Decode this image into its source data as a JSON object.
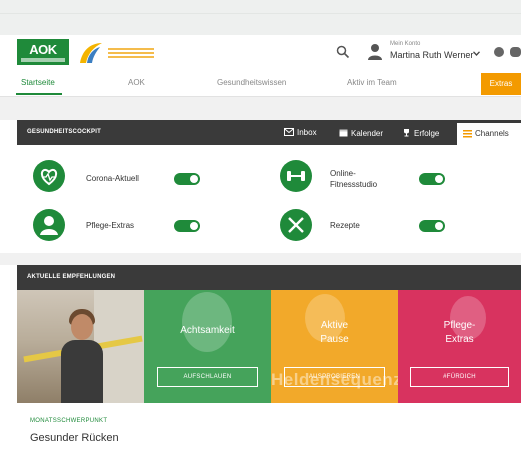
{
  "header": {
    "account_label": "Mein Konto",
    "account_name": "Martina Ruth Werner"
  },
  "nav": {
    "items": [
      "Startseite",
      "AOK",
      "Gesundheitswissen",
      "Aktiv im Team",
      "Extras"
    ],
    "active": "Startseite"
  },
  "cockpit": {
    "title": "GESUNDHEITSCOCKPIT",
    "tabs": [
      {
        "label": "Inbox",
        "icon": "envelope-icon"
      },
      {
        "label": "Kalender",
        "icon": "calendar-icon"
      },
      {
        "label": "Erfolge",
        "icon": "trophy-icon"
      },
      {
        "label": "Channels",
        "icon": "channels-icon",
        "active": true
      }
    ],
    "channels": [
      {
        "label": "Corona-Aktuell",
        "icon": "heart-icon",
        "enabled": true
      },
      {
        "label": "Online-\nFitnessstudio",
        "icon": "dumbbell-icon",
        "enabled": true
      },
      {
        "label": "Pflege-Extras",
        "icon": "care-person-icon",
        "enabled": true
      },
      {
        "label": "Rezepte",
        "icon": "cutlery-icon",
        "enabled": true
      }
    ]
  },
  "recommendations": {
    "title": "AKTUELLE EMPFEHLUNGEN",
    "panels": [
      {
        "title": "Achtsamkeit",
        "button": "AUFSCHLAUEN"
      },
      {
        "title": "Aktive\nPause",
        "button": "AUSPROBIEREN",
        "overlay_text": "Heldensequenz"
      },
      {
        "title": "Pflege-\nExtras",
        "button": "#FÜRDICH"
      }
    ]
  },
  "monat": {
    "kicker": "MONATSSCHWERPUNKT",
    "title": "Gesunder Rücken"
  },
  "colors": {
    "brand_green": "#1f8a3a",
    "extras_orange": "#f39a00",
    "panel_green": "#45a35b",
    "panel_orange": "#f2a92a",
    "panel_pink": "#d8335f",
    "dark_bar": "#3a3a3a"
  }
}
